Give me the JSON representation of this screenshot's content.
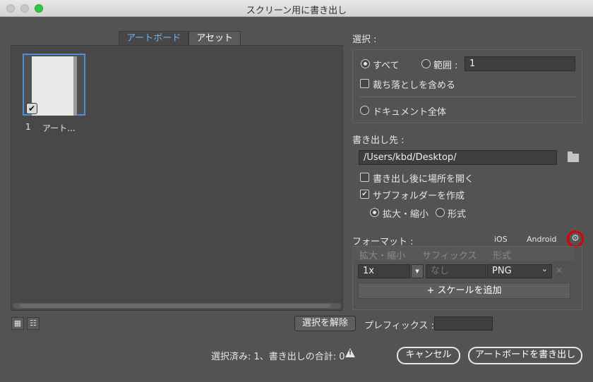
{
  "window": {
    "title": "スクリーン用に書き出し"
  },
  "tabs": {
    "artboard": "アートボード",
    "asset": "アセット"
  },
  "thumbnail": {
    "number": "1",
    "name": "アート...",
    "check": "✔"
  },
  "selection": {
    "heading": "選択 :",
    "all": "すべて",
    "range": "範囲 :",
    "range_value": "1",
    "bleed": "裁ち落としを含める",
    "document": "ドキュメント全体"
  },
  "export_to": {
    "heading": "書き出し先 :",
    "path": "/Users/kbd/Desktop/",
    "open_after": "書き出し後に場所を開く",
    "create_subfolder": "サブフォルダーを作成",
    "check_mark": "✔",
    "scale_option": "拡大・縮小",
    "format_option": "形式"
  },
  "format": {
    "heading": "フォーマット :",
    "ios": "iOS",
    "android": "Android",
    "gear": "⚙",
    "col_scale": "拡大・縮小",
    "col_suffix": "サフィックス",
    "col_format": "形式",
    "row_scale": "1x",
    "row_suffix_placeholder": "なし",
    "row_format": "PNG",
    "dropdown_arrow": "▾",
    "chevron": "⌄",
    "remove": "✕",
    "add_scale": "+ スケールを追加"
  },
  "bottom": {
    "grid_icon": "▦",
    "list_icon": "☷",
    "deselect": "選択を解除",
    "prefix_label": "プレフィックス :",
    "status": "選択済み: 1、書き出しの合計: 0",
    "warning_mark": "!",
    "cancel": "キャンセル",
    "export": "アートボードを書き出し"
  }
}
